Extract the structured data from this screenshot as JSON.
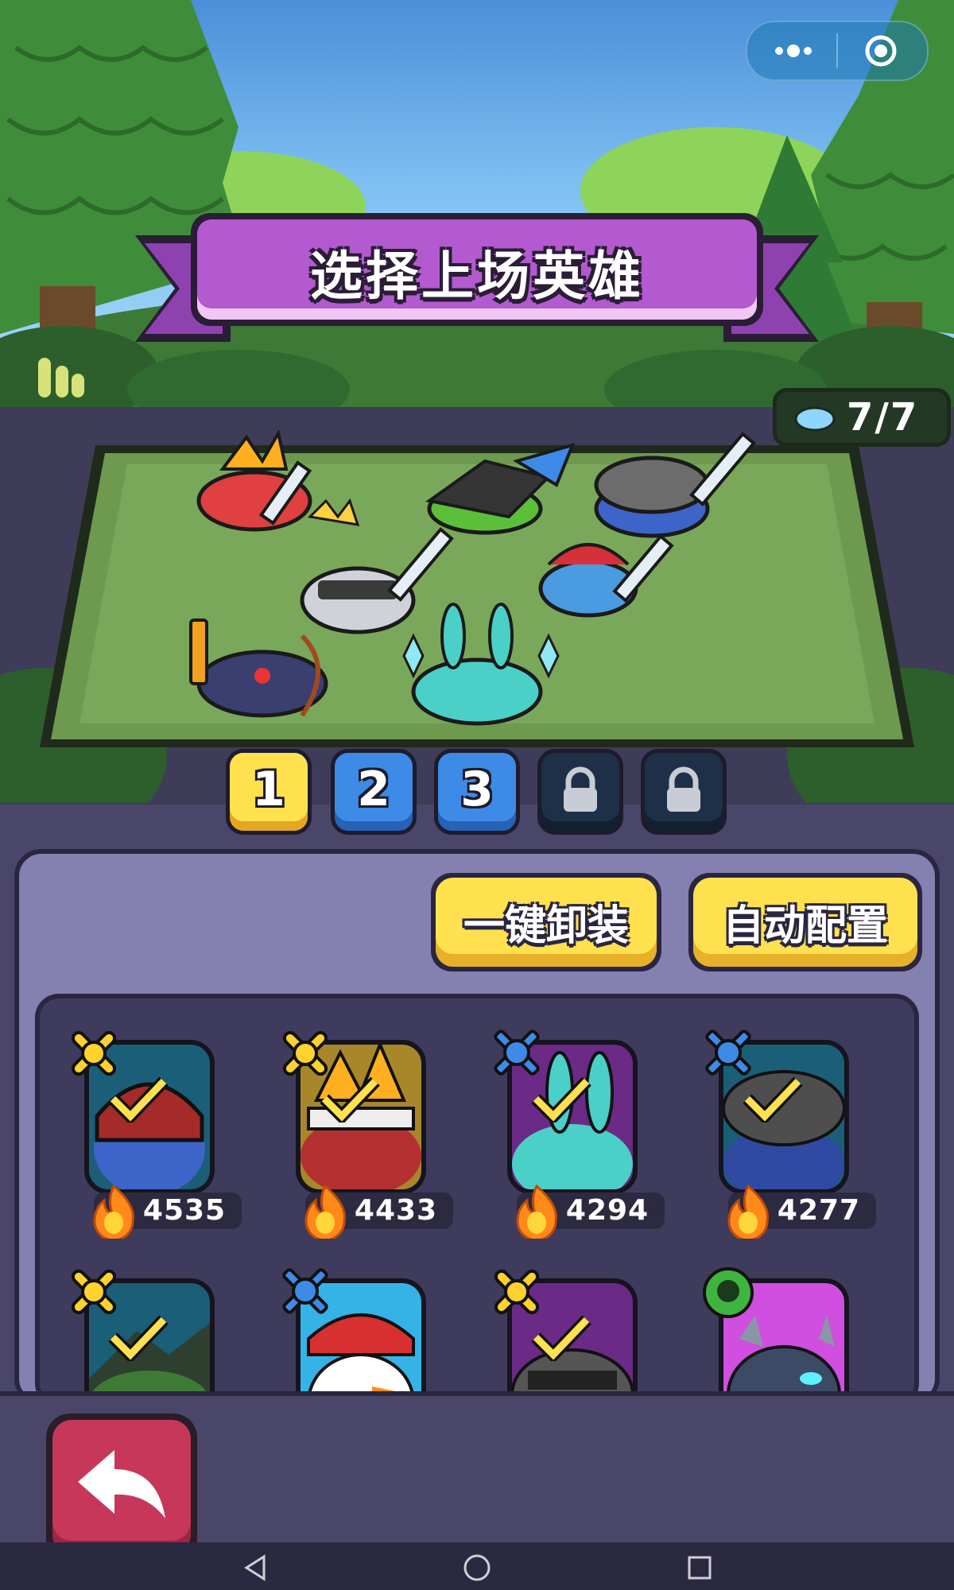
{
  "title": "选择上场英雄",
  "capsule": {
    "menu_icon": "more-dots-icon",
    "close_icon": "record-circle-icon"
  },
  "team_count": "7/7",
  "team_tabs": [
    {
      "label": "1",
      "state": "selected"
    },
    {
      "label": "2",
      "state": "available"
    },
    {
      "label": "3",
      "state": "available"
    },
    {
      "label": "",
      "state": "locked"
    },
    {
      "label": "",
      "state": "locked"
    }
  ],
  "buttons": {
    "unequip_all": "一键卸装",
    "auto_config": "自动配置"
  },
  "heroes": [
    {
      "power": "4535",
      "class_icon": "crossed-bones-icon",
      "selected": true,
      "color": "#1b5e78"
    },
    {
      "power": "4433",
      "class_icon": "crossed-bones-icon",
      "selected": true,
      "color": "#a8862a"
    },
    {
      "power": "4294",
      "class_icon": "crossed-swords-blue-icon",
      "selected": true,
      "color": "#6a2a86"
    },
    {
      "power": "4277",
      "class_icon": "crossed-swords-blue-icon",
      "selected": true,
      "color": "#1b5e78"
    },
    {
      "power": "",
      "class_icon": "crossed-bones-icon",
      "selected": true,
      "color": "#1b5e78"
    },
    {
      "power": "",
      "class_icon": "crossed-swords-blue-icon",
      "selected": false,
      "color": "#36b3e6"
    },
    {
      "power": "",
      "class_icon": "crossed-bones-icon",
      "selected": true,
      "color": "#6a2a86"
    },
    {
      "power": "",
      "class_icon": "green-skull-gear-icon",
      "selected": false,
      "color": "#d04ee0"
    }
  ],
  "back_button_icon": "back-arrow-icon",
  "system_nav": {
    "back": "triangle-back-icon",
    "home": "circle-home-icon",
    "recents": "square-recents-icon"
  }
}
